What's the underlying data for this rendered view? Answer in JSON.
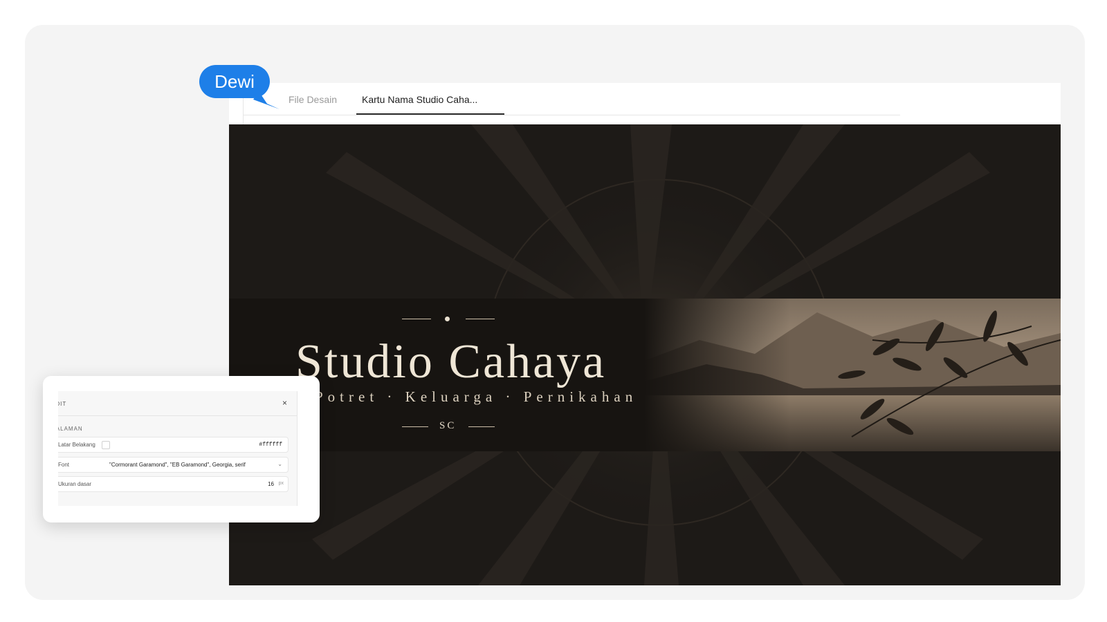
{
  "cursor": {
    "user_name": "Dewi",
    "color": "#1e7fe8"
  },
  "tabs": [
    {
      "label": "File Desain"
    },
    {
      "label": "Kartu Nama Studio Caha..."
    }
  ],
  "design": {
    "title": "Studio Cahaya",
    "subtitle": "Potret · Keluarga · Pernikahan",
    "monogram": "SC",
    "background_color": "#1c1916",
    "text_color": "#efe6d6"
  },
  "edit_panel": {
    "header": "EDIT",
    "close_label": "×",
    "section_label": "HALAMAN",
    "fields": {
      "background": {
        "label": "Latar Belakang",
        "value": "#ffffff"
      },
      "font": {
        "label": "Font",
        "value": "\"Cormorant Garamond\", \"EB Garamond\", Georgia, serif"
      },
      "base_size": {
        "label": "Ukuran dasar",
        "value": "16",
        "unit": "px"
      }
    }
  }
}
